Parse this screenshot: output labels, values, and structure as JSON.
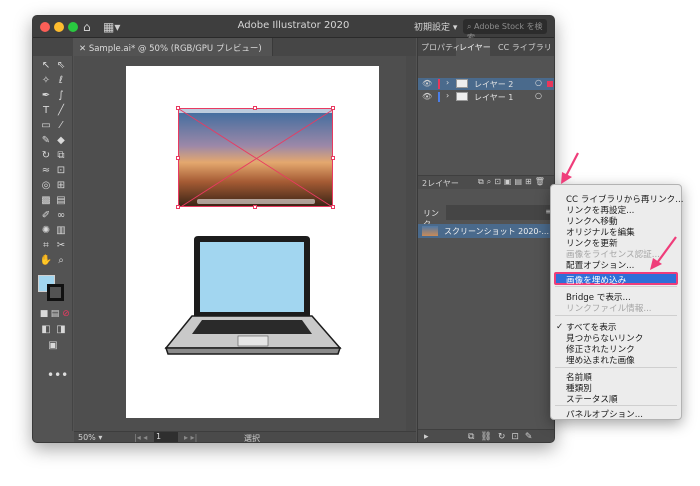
{
  "app": {
    "title": "Adobe Illustrator 2020",
    "workspace": "初期設定",
    "stock_search_placeholder": "Adobe Stock を検索"
  },
  "document_tab": {
    "label": "Sample.ai* @ 50% (RGB/GPU プレビュー)"
  },
  "status_bar": {
    "zoom": "50%",
    "page": "1",
    "mode": "選択"
  },
  "right_panel": {
    "tabs": [
      "プロパティ",
      "レイヤー",
      "CC ライブラリ"
    ],
    "active_tab": "レイヤー",
    "layers": [
      {
        "name": "レイヤー 2",
        "color": "#e9375a",
        "selected": true
      },
      {
        "name": "レイヤー 1",
        "color": "#4a7ee8",
        "selected": false
      }
    ],
    "layer_count": "2レイヤー"
  },
  "links_panel": {
    "title": "リンク",
    "items": [
      {
        "name": "スクリーンショット 2020-..."
      }
    ]
  },
  "context_menu": {
    "items": [
      {
        "label": "CC ライブラリから再リンク...",
        "disabled": false
      },
      {
        "label": "リンクを再設定...",
        "disabled": false
      },
      {
        "label": "リンクへ移動",
        "disabled": false
      },
      {
        "label": "オリジナルを編集",
        "disabled": false
      },
      {
        "label": "リンクを更新",
        "disabled": false
      },
      {
        "label": "画像をライセンス認証...",
        "disabled": true
      },
      {
        "label": "配置オプション...",
        "disabled": false
      }
    ],
    "highlighted": "画像を埋め込み",
    "group2": [
      {
        "label": "Bridge で表示...",
        "disabled": false
      },
      {
        "label": "リンクファイル情報...",
        "disabled": true
      }
    ],
    "group3": [
      {
        "label": "すべてを表示",
        "checked": true
      },
      {
        "label": "見つからないリンク",
        "checked": false
      },
      {
        "label": "修正されたリンク",
        "checked": false
      },
      {
        "label": "埋め込まれた画像",
        "checked": false
      }
    ],
    "group4": [
      {
        "label": "名前順"
      },
      {
        "label": "種類別"
      },
      {
        "label": "ステータス順"
      }
    ],
    "group5": [
      {
        "label": "パネルオプション..."
      }
    ]
  },
  "colors": {
    "accent_pink": "#ef3d7a",
    "selection_blue": "#2f6fd8",
    "fill_swatch": "#a2d6f0",
    "layer2_color": "#e9375a",
    "layer1_color": "#4a7ee8"
  }
}
